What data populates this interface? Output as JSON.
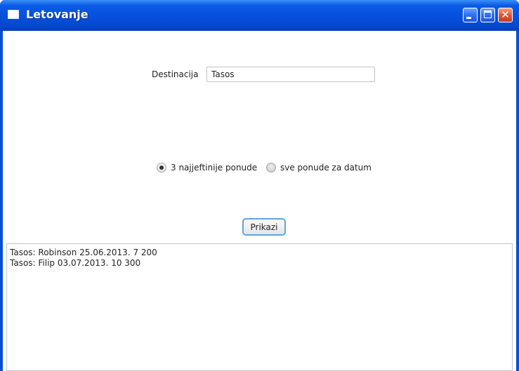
{
  "window": {
    "title": "Letovanje",
    "icons": {
      "app": "window-icon",
      "minimize": "minimize-icon",
      "maximize": "maximize-icon",
      "close": "close-icon"
    },
    "close_glyph": "✕"
  },
  "form": {
    "destination_label": "Destinacija",
    "destination_value": "Tasos",
    "options": [
      {
        "label": "3 najjeftinije ponude",
        "selected": true
      },
      {
        "label": "sve ponude za datum",
        "selected": false
      }
    ],
    "show_button_label": "Prikazi"
  },
  "output": {
    "lines": [
      "Tasos: Robinson 25.06.2013. 7 200",
      "Tasos: Filip 03.07.2013. 10 300"
    ]
  },
  "colors": {
    "titlebar": "#0651df",
    "close_button": "#e05a34",
    "focus_border": "#5aa6e6"
  }
}
